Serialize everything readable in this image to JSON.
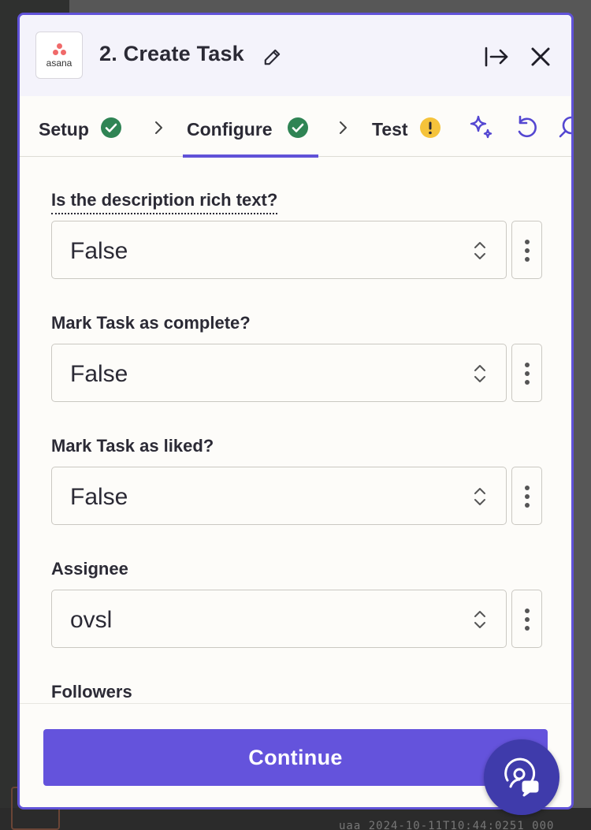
{
  "background": {
    "bottom_text": "uaa 2024-10-11T10:44:0251 000"
  },
  "header": {
    "app_logo_text": "asana",
    "title": "2. Create Task"
  },
  "tabs": [
    {
      "label": "Setup",
      "status": "complete"
    },
    {
      "label": "Configure",
      "status": "complete",
      "active": true
    },
    {
      "label": "Test",
      "status": "warning"
    }
  ],
  "fields": [
    {
      "label": "Is the description rich text?",
      "value": "False"
    },
    {
      "label": "Mark Task as complete?",
      "value": "False"
    },
    {
      "label": "Mark Task as liked?",
      "value": "False"
    },
    {
      "label": "Assignee",
      "value": "ovsl"
    },
    {
      "label": "Followers"
    }
  ],
  "footer": {
    "continue_label": "Continue"
  },
  "colors": {
    "accent": "#6052d8",
    "button": "#6453dc",
    "success": "#2f8454",
    "warning": "#f5c33b",
    "fab": "#3f3bab"
  },
  "icons": {
    "edit": "pencil-icon",
    "collapse": "collapse-panel-icon",
    "close": "close-icon",
    "ai": "sparkle-icon",
    "undo": "undo-icon",
    "search": "search-icon",
    "select": "updown-chevron-icon",
    "more": "vertical-dots-icon",
    "support": "support-chat-icon"
  }
}
